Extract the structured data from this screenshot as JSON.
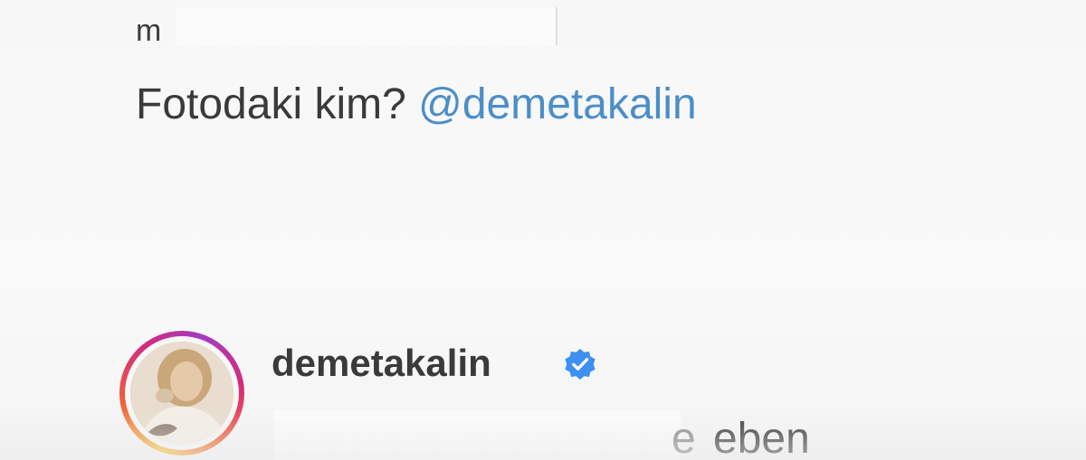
{
  "comment": {
    "username_visible": "m",
    "text": "Fotodaki kim?",
    "mention": "@demetakalin"
  },
  "reply": {
    "username": "demetakalin",
    "verified_icon": "verified-badge-icon",
    "partial_char": "e",
    "text_visible": "eben"
  },
  "colors": {
    "mention": "#4b8ec8",
    "verified": "#3d8ff0",
    "text": "#3a3a3a",
    "ring_start": "#f9c23c",
    "ring_mid": "#d32b7c",
    "ring_end": "#a23cc0"
  }
}
